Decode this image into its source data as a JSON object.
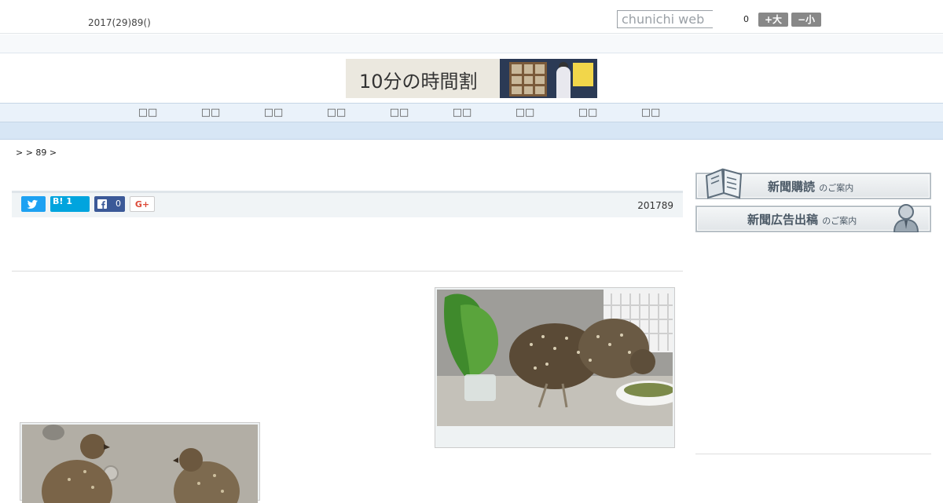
{
  "header": {
    "date": "2017(29)89()",
    "search_placeholder": "chunichi web",
    "font_size_value": "0",
    "font_big_label": "+大",
    "font_small_label": "−小"
  },
  "banner": {
    "text": "10分の時間割"
  },
  "nav": {
    "items": [
      "□□",
      "□□",
      "□□",
      "□□",
      "□□",
      "□□",
      "□□",
      "□□",
      "□□"
    ]
  },
  "breadcrumb": {
    "text": ">  > 89 >"
  },
  "share": {
    "hatena_label": "B! 1",
    "facebook_count": "0",
    "gplus_label": "G+",
    "article_date": "201789"
  },
  "sidebar": {
    "subscribe_main": "新聞購読",
    "subscribe_suffix": "のご案内",
    "ad_main": "新聞広告出稿",
    "ad_suffix": "のご案内"
  },
  "colors": {
    "twitter": "#1da1f2",
    "hatena": "#00a4de",
    "facebook": "#3b5998",
    "nav_bg": "#eaf2fa"
  }
}
